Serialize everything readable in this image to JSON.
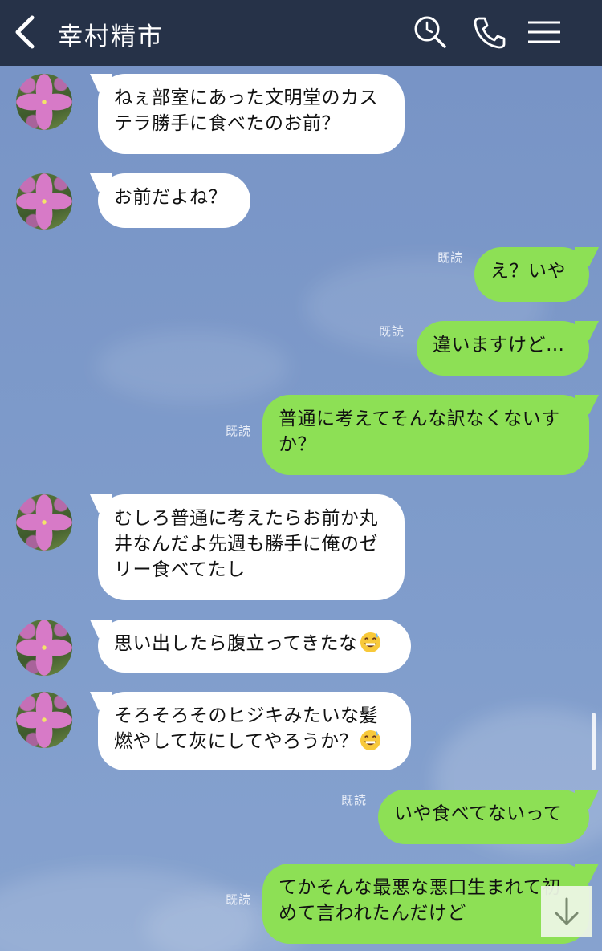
{
  "header": {
    "title": "幸村精市",
    "background": "#263248"
  },
  "colors": {
    "left_bubble": "#ffffff",
    "right_bubble": "#8de055",
    "chat_background": "#7e9cc8"
  },
  "messages": [
    {
      "side": "left",
      "text": "ねぇ部室にあった文明堂のカス\nテラ勝手に食べたのお前？"
    },
    {
      "side": "left",
      "text": "お前だよね？"
    },
    {
      "side": "right",
      "read": "既読",
      "text": "え？いや"
    },
    {
      "side": "right",
      "read": "既読",
      "text": "違いますけど…"
    },
    {
      "side": "right",
      "read": "既読",
      "text": "普通に考えてそんな訳なくないす\nか？"
    },
    {
      "side": "left",
      "text": "むしろ普通に考えたらお前か丸\n井なんだよ先週も勝手に俺のゼ\nリー食べてたし"
    },
    {
      "side": "left",
      "text": "思い出したら腹立ってきたな",
      "emoji": "grinning-sweat-emoji"
    },
    {
      "side": "left",
      "text": "そろそろそのヒジキみたいな髪\n燃やして灰にしてやろうか？",
      "emoji": "grinning-sweat-emoji"
    },
    {
      "side": "right",
      "read": "既読",
      "text": "いや食べてないって"
    },
    {
      "side": "right",
      "read": "既読",
      "text": "てかそんな最悪な悪口生まれて初\nめて言われたんだけど"
    }
  ],
  "icons": {
    "back": "chevron-left-icon",
    "search": "search-icon",
    "call": "phone-icon",
    "menu": "menu-icon",
    "scroll_down": "arrow-down-icon"
  }
}
